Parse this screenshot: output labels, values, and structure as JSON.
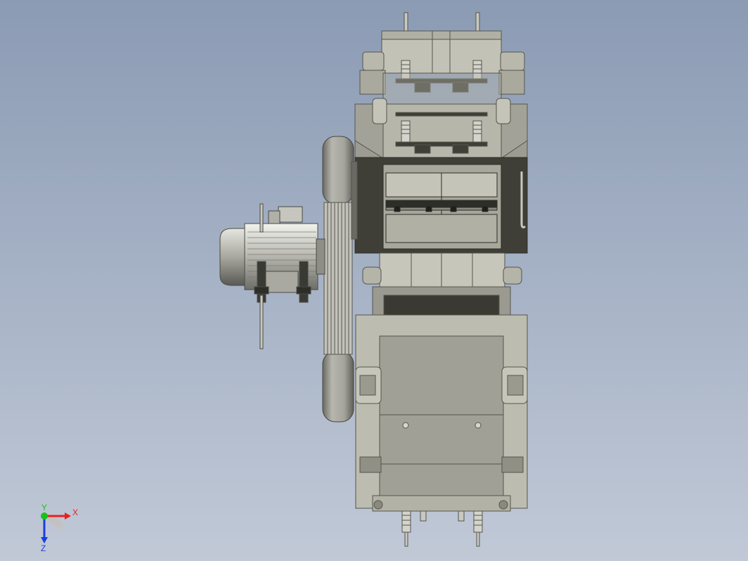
{
  "viewport": {
    "background_top": "#8b9bb4",
    "background_bottom": "#c1c9d7"
  },
  "model": {
    "colors": {
      "body": "#b4b4a8",
      "body_light": "#c9c9bd",
      "body_dark": "#8e8e84",
      "dark_panel": "#3f3f38",
      "edge": "#55554e",
      "pulley": "#9a9a92",
      "motor": "#bfbfb8"
    }
  },
  "triad": {
    "x_label": "X",
    "y_label": "Y",
    "z_label": "Z",
    "x_color": "#e8201c",
    "y_color": "#16c21a",
    "z_color": "#1c3ce0"
  }
}
